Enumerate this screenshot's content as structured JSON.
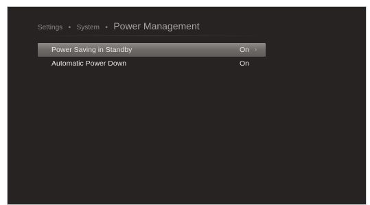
{
  "breadcrumb": {
    "level1": "Settings",
    "level2": "System",
    "current": "Power Management",
    "separator": "•"
  },
  "menu": {
    "items": [
      {
        "label": "Power Saving in Standby",
        "value": "On",
        "arrow": "›"
      },
      {
        "label": "Automatic Power Down",
        "value": "On"
      }
    ]
  },
  "colors": {
    "background": "#262322",
    "selected_bar": "#7a7674",
    "text": "#e9e6e4",
    "breadcrumb_text": "#8c8886"
  }
}
